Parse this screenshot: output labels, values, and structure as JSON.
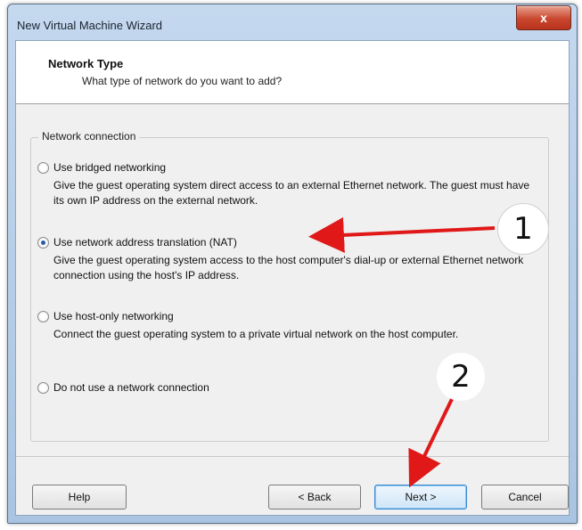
{
  "window": {
    "title": "New Virtual Machine Wizard",
    "close_label": "x"
  },
  "header": {
    "title": "Network Type",
    "subtitle": "What type of network do you want to add?"
  },
  "group": {
    "label": "Network connection"
  },
  "options": [
    {
      "label": "Use bridged networking",
      "description": "Give the guest operating system direct access to an external Ethernet network. The guest must have its own IP address on the external network.",
      "checked": false
    },
    {
      "label": "Use network address translation (NAT)",
      "description": "Give the guest operating system access to the host computer's dial-up or external Ethernet network connection using the host's IP address.",
      "checked": true
    },
    {
      "label": "Use host-only networking",
      "description": "Connect the guest operating system to a private virtual network on the host computer.",
      "checked": false
    },
    {
      "label": "Do not use a network connection",
      "description": "",
      "checked": false
    }
  ],
  "buttons": {
    "help": "Help",
    "back": "< Back",
    "next": "Next >",
    "cancel": "Cancel"
  },
  "annotations": {
    "marker_1": "1",
    "marker_2": "2",
    "arrow_color": "#e01818"
  }
}
